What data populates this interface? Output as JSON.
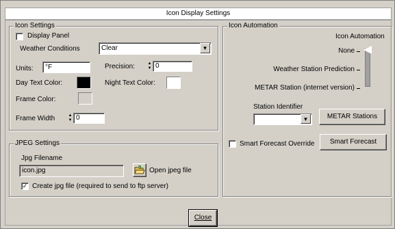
{
  "window": {
    "title": "Icon Display Settings"
  },
  "icon_settings": {
    "legend": "Icon Settings",
    "display_panel_label": "Display Panel",
    "display_panel_checked": false,
    "weather_conditions_label": "Weather Conditions",
    "weather_conditions_value": "Clear",
    "units_label": "Units:",
    "units_value": "°F",
    "precision_label": "Precision:",
    "precision_value": "0",
    "day_text_color_label": "Day Text Color:",
    "day_text_color": "#000000",
    "night_text_color_label": "Night Text Color:",
    "night_text_color": "#ffffff",
    "frame_color_label": "Frame Color:",
    "frame_color": "#d4d0c8",
    "frame_width_label": "Frame Width",
    "frame_width_value": "0"
  },
  "jpeg_settings": {
    "legend": "JPEG Settings",
    "filename_label": "Jpg Filename",
    "filename_value": "icon.jpg",
    "open_button_label": "Open jpeg file",
    "create_jpg_label": "Create jpg file (required to send to ftp server)",
    "create_jpg_checked": true
  },
  "icon_automation": {
    "legend": "Icon Automation",
    "slider_title": "Icon Automation",
    "options": [
      "None",
      "Weather Station Prediction",
      "METAR Station (internet version)"
    ],
    "selected_option": "None",
    "station_identifier_label": "Station Identifier",
    "station_identifier_value": "",
    "metar_button_label": "METAR Stations",
    "smart_override_label": "Smart Forecast Override",
    "smart_override_checked": false,
    "smart_forecast_button_label": "Smart Forecast"
  },
  "footer": {
    "close_label": "Close"
  },
  "icons": {
    "dropdown": "chevron-down-icon",
    "spinner": "spinner-arrows-icon",
    "open": "folder-open-icon",
    "check": "checkmark-icon"
  }
}
